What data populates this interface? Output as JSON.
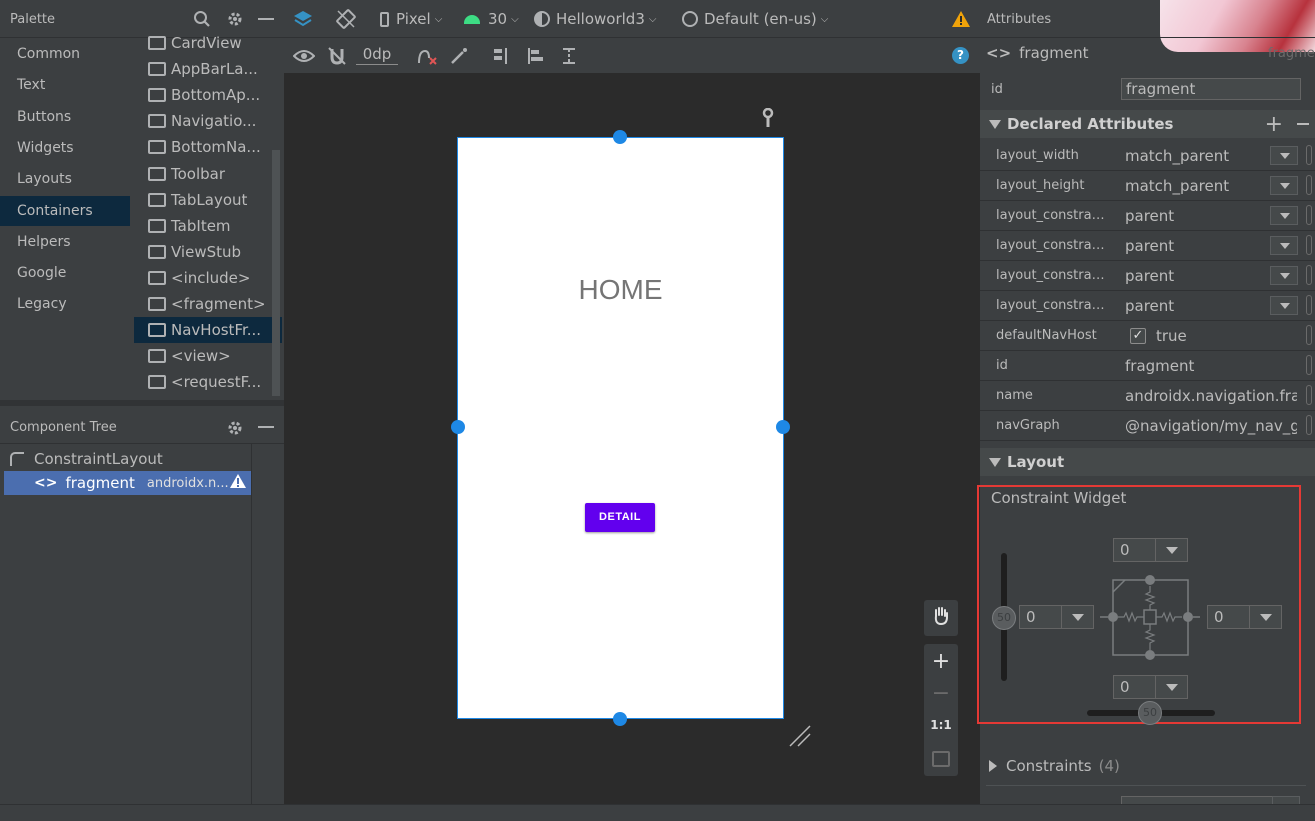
{
  "palette": {
    "title": "Palette",
    "categories": [
      "Common",
      "Text",
      "Buttons",
      "Widgets",
      "Layouts",
      "Containers",
      "Helpers",
      "Google",
      "Legacy"
    ],
    "selected_category": "Containers",
    "widgets": [
      "CardView",
      "AppBarLa...",
      "BottomAp...",
      "Navigatio...",
      "BottomNa...",
      "Toolbar",
      "TabLayout",
      "TabItem",
      "ViewStub",
      "<include>",
      "<fragment>",
      "NavHostFr...",
      "<view>",
      "<requestF..."
    ],
    "selected_widget": "NavHostFr..."
  },
  "component_tree": {
    "title": "Component Tree",
    "root": "ConstraintLayout",
    "child_label": "fragment",
    "child_detail": "androidx.n..."
  },
  "toolbar": {
    "device": "Pixel",
    "api": "30",
    "theme": "Helloworld3",
    "locale": "Default (en-us)",
    "margin": "0dp"
  },
  "design": {
    "home_label": "HOME",
    "detail_button": "DETAIL",
    "zoom_fit": "1:1"
  },
  "attributes": {
    "title": "Attributes",
    "component": "fragment",
    "component_faded": "fragme",
    "id_label": "id",
    "id_value": "fragment",
    "declared_title": "Declared Attributes",
    "declared": [
      {
        "key": "layout_width",
        "value": "match_parent",
        "dropdown": true
      },
      {
        "key": "layout_height",
        "value": "match_parent",
        "dropdown": true
      },
      {
        "key": "layout_constrain...",
        "value": "parent",
        "dropdown": true
      },
      {
        "key": "layout_constrain...",
        "value": "parent",
        "dropdown": true
      },
      {
        "key": "layout_constrain...",
        "value": "parent",
        "dropdown": true
      },
      {
        "key": "layout_constrain...",
        "value": "parent",
        "dropdown": true
      },
      {
        "key": "defaultNavHost",
        "value": "true",
        "checkbox": true
      },
      {
        "key": "id",
        "value": "fragment"
      },
      {
        "key": "name",
        "value": "androidx.navigation.frag"
      },
      {
        "key": "navGraph",
        "value": "@navigation/my_nav_gr"
      }
    ],
    "layout_title": "Layout",
    "constraint_widget_title": "Constraint Widget",
    "margin_top": "0",
    "margin_left": "0",
    "margin_right": "0",
    "margin_bottom": "0",
    "vertical_bias": "50",
    "horizontal_bias": "50",
    "constraints_title": "Constraints",
    "constraints_count": "(4)"
  },
  "colors": {
    "accent_blue": "#1e88e5",
    "button_purple": "#6200ee",
    "highlight_red": "#e53935",
    "warning": "#f0a30a"
  }
}
